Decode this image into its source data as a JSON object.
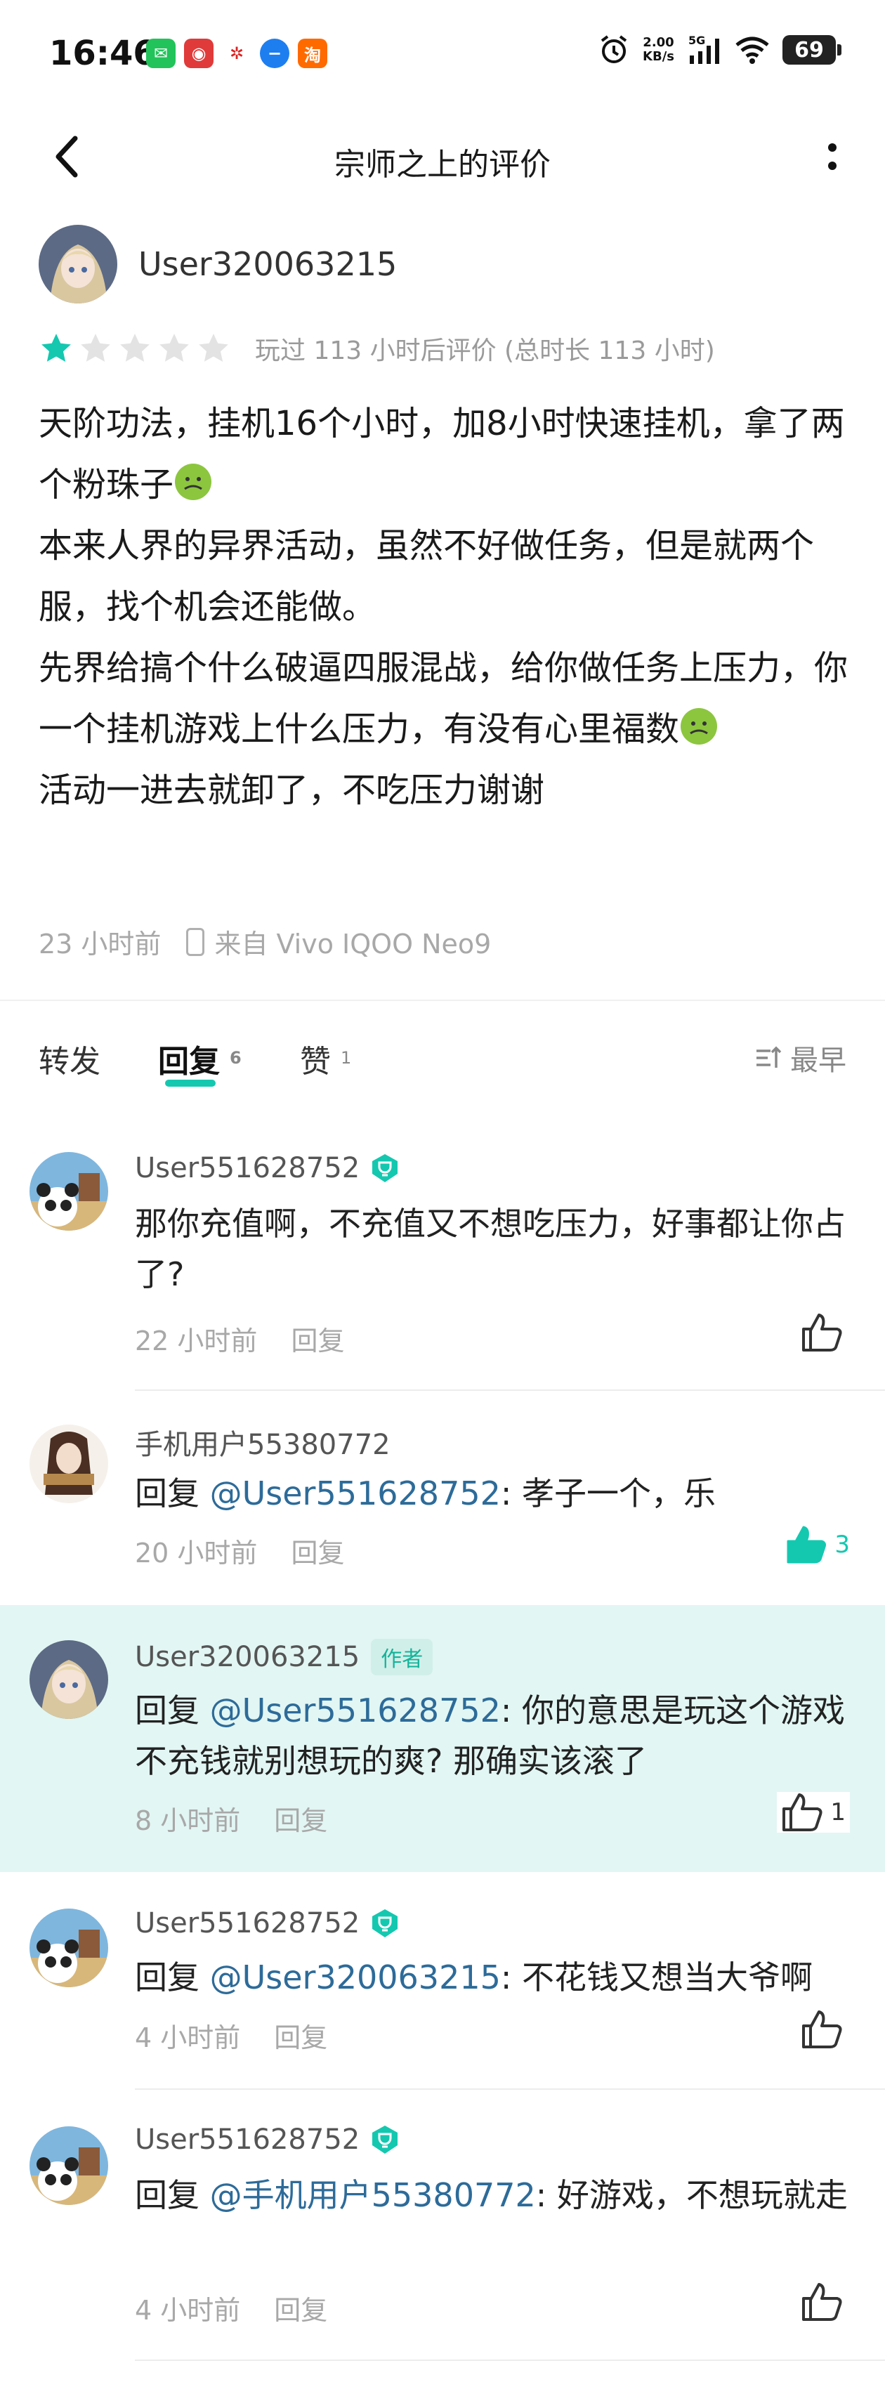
{
  "status": {
    "time": "16:46",
    "net_speed_value": "2.00",
    "net_speed_unit": "KB/s",
    "network": "5G",
    "battery": "69",
    "app_icons": [
      "wechat-icon",
      "weibo-icon",
      "unicom-icon",
      "message-icon",
      "taobao-icon"
    ]
  },
  "header": {
    "title": "宗师之上的评价"
  },
  "review": {
    "author": "User320063215",
    "rating": 1,
    "rating_max": 5,
    "playtime": "玩过 113 小时后评价 (总时长 113 小时)",
    "body_lines": [
      "天阶功法，挂机16个小时，加8小时快速挂机，拿了两个粉珠子",
      "本来人界的异界活动，虽然不好做任务，但是就两个服，找个机会还能做。",
      "先界给搞个什么破逼四服混战，给你做任务上压力，你一个挂机游戏上什么压力，有没有心里福数",
      "活动一进去就卸了，不吃压力谢谢"
    ],
    "time": "23 小时前",
    "device": "来自 Vivo IQOO Neo9"
  },
  "tabs": {
    "forward": "转发",
    "reply": "回复",
    "reply_count": "6",
    "like": "赞",
    "like_count": "1",
    "sort": "最早"
  },
  "comments": [
    {
      "name": "User551628752",
      "badge": true,
      "text": "那你充值啊，不充值又不想吃压力，好事都让你占了?",
      "mention": "",
      "time": "22 小时前",
      "reply": "回复",
      "likes": ""
    },
    {
      "name": "手机用户55380772",
      "badge": false,
      "prefix": "回复 ",
      "mention": "@User551628752",
      "text": ": 孝子一个，乐",
      "time": "20 小时前",
      "reply": "回复",
      "likes": "3"
    },
    {
      "name": "User320063215",
      "author_tag": "作者",
      "prefix": "回复 ",
      "mention": "@User551628752",
      "text": ": 你的意思是玩这个游戏不充钱就别想玩的爽? 那确实该滚了",
      "time": "8 小时前",
      "reply": "回复",
      "likes": "1"
    },
    {
      "name": "User551628752",
      "badge": true,
      "prefix": "回复 ",
      "mention": "@User320063215",
      "text": ": 不花钱又想当大爷啊",
      "time": "4 小时前",
      "reply": "回复",
      "likes": ""
    },
    {
      "name": "User551628752",
      "badge": true,
      "prefix": "回复 ",
      "mention": "@手机用户55380772",
      "text": ": 好游戏，不想玩就走",
      "time": "4 小时前",
      "reply": "回复",
      "likes": ""
    }
  ],
  "colors": {
    "accent": "#14c8b0",
    "mention": "#2d6b99",
    "highlight_bg": "#e2f6f3"
  }
}
